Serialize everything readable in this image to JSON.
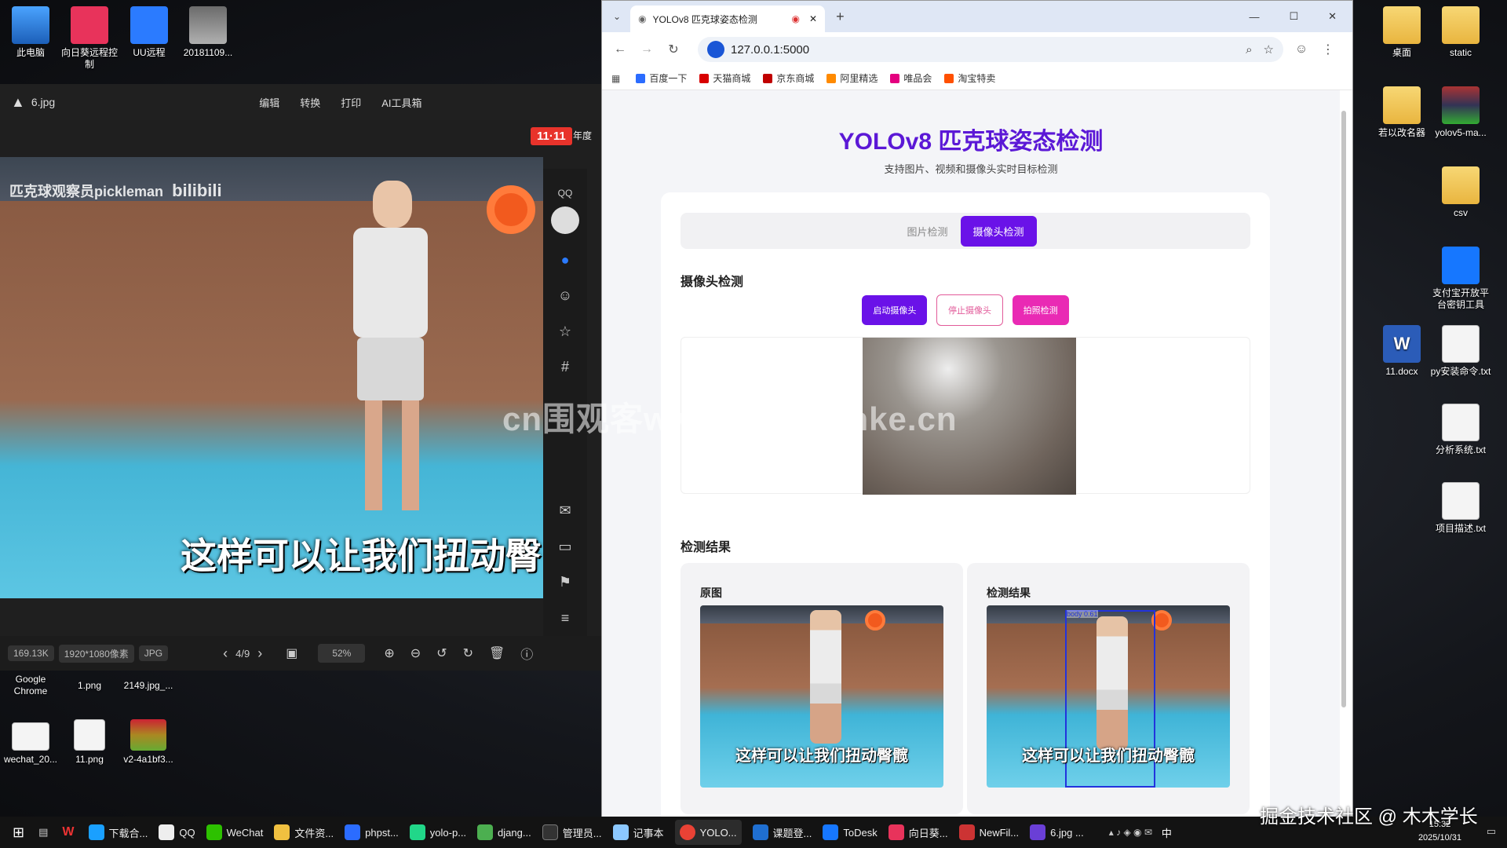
{
  "desktop_left": [
    {
      "label": "此电脑",
      "icon": "pc-icon"
    },
    {
      "label": "向日葵远程控制",
      "icon": "sunflower-icon"
    },
    {
      "label": "UU远程",
      "icon": "uu-icon"
    },
    {
      "label": "20181109...",
      "icon": "photo-icon"
    }
  ],
  "desktop_bottom": [
    {
      "label": "Google Chrome"
    },
    {
      "label": "1.png"
    },
    {
      "label": "2149.jpg_..."
    },
    {
      "label": "wechat_20..."
    },
    {
      "label": "11.png"
    },
    {
      "label": "v2-4a1bf3..."
    }
  ],
  "desktop_right": [
    {
      "label": "桌面"
    },
    {
      "label": "static"
    },
    {
      "label": "若以改名器"
    },
    {
      "label": "yolov5-ma..."
    },
    {
      "label": "csv"
    },
    {
      "label": "支付宝开放平台密钥工具"
    },
    {
      "label": "11.docx"
    },
    {
      "label": "py安装命令.txt"
    },
    {
      "label": "分析系统.txt"
    },
    {
      "label": "项目描述.txt"
    }
  ],
  "viewer": {
    "filename": "6.jpg",
    "menu": [
      "编辑",
      "转换",
      "打印",
      "AI工具箱"
    ],
    "promo": "11·11",
    "promo_tag": "年度",
    "overlay_title": "匹克球观察员pickleman",
    "bili": "bilibili",
    "caption": "这样可以让我们扭动臀",
    "file_size": "169.13K",
    "dims": "1920*1080像素",
    "format": "JPG",
    "page": "4/9",
    "zoom": "52%",
    "qq": "QQ"
  },
  "browser": {
    "tab_title": "YOLOv8 匹克球姿态检测",
    "url": "127.0.0.1:5000",
    "bookmarks": [
      "百度一下",
      "天猫商城",
      "京东商城",
      "阿里精选",
      "唯品会",
      "淘宝特卖"
    ],
    "bookmark_colors": [
      "#2b6cff",
      "#d80000",
      "#c00000",
      "#ff8a00",
      "#e4007f",
      "#ff5000"
    ]
  },
  "page": {
    "title": "YOLOv8 匹克球姿态检测",
    "subtitle": "支持图片、视频和摄像头实时目标检测",
    "tabs": [
      "图片检测",
      "摄像头检测"
    ],
    "camera_section": "摄像头检测",
    "buttons": {
      "start": "启动摄像头",
      "stop": "停止摄像头",
      "snap": "拍照检测"
    },
    "results_section": "检测结果",
    "original_label": "原图",
    "result_label": "检测结果",
    "result_caption": "这样可以让我们扭动臀髋",
    "detect_tag": "body 0.61"
  },
  "watermark": "cn围观客www.weiguanke.cn",
  "taskbar": {
    "items": [
      "下载合...",
      "QQ",
      "WeChat",
      "文件资...",
      "phpst...",
      "yolo-p...",
      "djang...",
      "管理员...",
      "记事本",
      "YOLO...",
      "课题登...",
      "ToDesk",
      "向日葵...",
      "NewFil...",
      "6.jpg ..."
    ],
    "time": "15:32",
    "date": "2025/10/31",
    "ime": "中"
  },
  "corner_watermark": "掘金技术社区 @ 木木学长"
}
